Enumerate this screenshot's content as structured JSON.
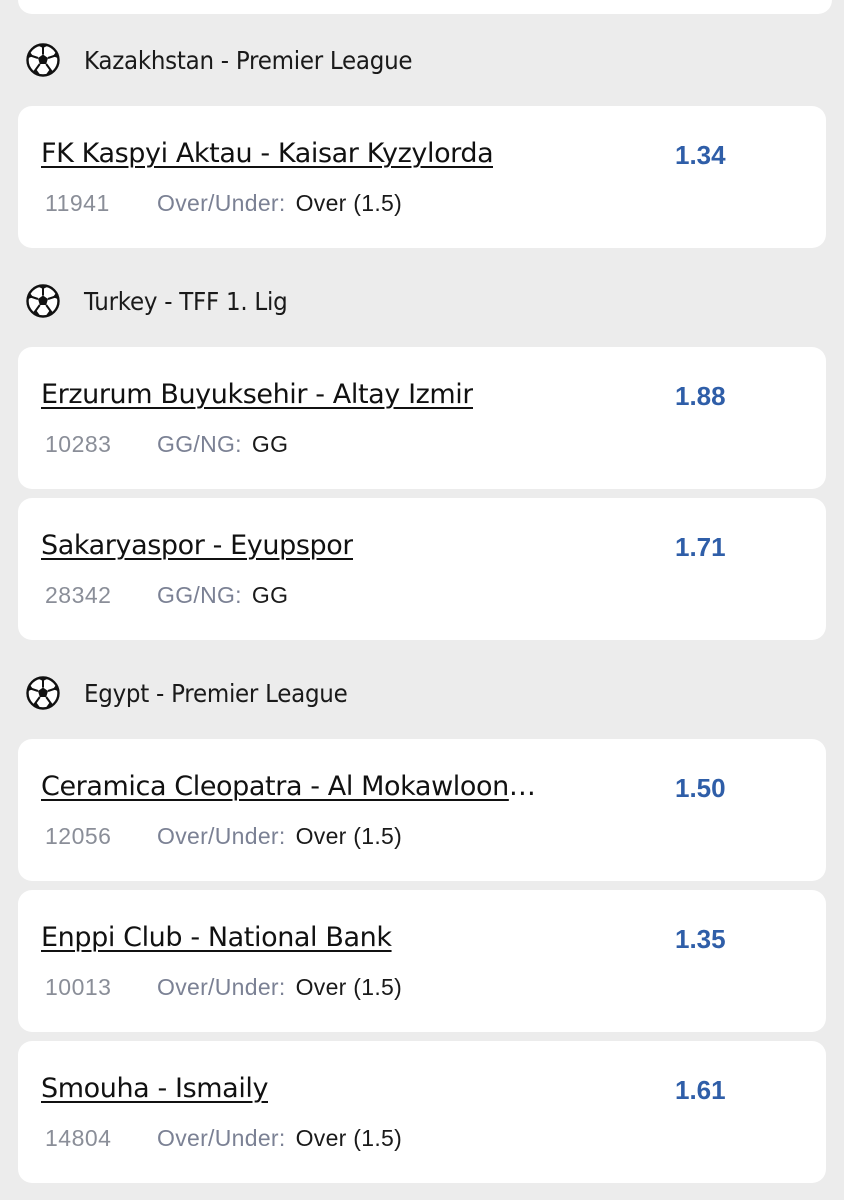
{
  "sections": [
    {
      "league": "Kazakhstan - Premier League",
      "bets": [
        {
          "match": "FK Kaspyi Aktau - Kaisar Kyzylorda",
          "code": "11941",
          "market": "Over/Under:",
          "pick": "Over (1.5)",
          "odds": "1.34"
        }
      ]
    },
    {
      "league": "Turkey - TFF 1. Lig",
      "bets": [
        {
          "match": "Erzurum Buyuksehir - Altay Izmir",
          "code": "10283",
          "market": "GG/NG:",
          "pick": "GG",
          "odds": "1.88"
        },
        {
          "match": "Sakaryaspor - Eyupspor",
          "code": "28342",
          "market": "GG/NG:",
          "pick": "GG",
          "odds": "1.71"
        }
      ]
    },
    {
      "league": "Egypt - Premier League",
      "bets": [
        {
          "match": "Ceramica Cleopatra - Al Mokawloon Al…",
          "code": "12056",
          "market": "Over/Under:",
          "pick": "Over (1.5)",
          "odds": "1.50"
        },
        {
          "match": "Enppi Club - National Bank",
          "code": "10013",
          "market": "Over/Under:",
          "pick": "Over (1.5)",
          "odds": "1.35"
        },
        {
          "match": "Smouha - Ismaily",
          "code": "14804",
          "market": "Over/Under:",
          "pick": "Over (1.5)",
          "odds": "1.61"
        }
      ]
    }
  ],
  "icons": {
    "league": "soccer-ball-icon"
  },
  "colors": {
    "odds": "#2f5ea8",
    "background": "#ececec",
    "card": "#ffffff"
  }
}
